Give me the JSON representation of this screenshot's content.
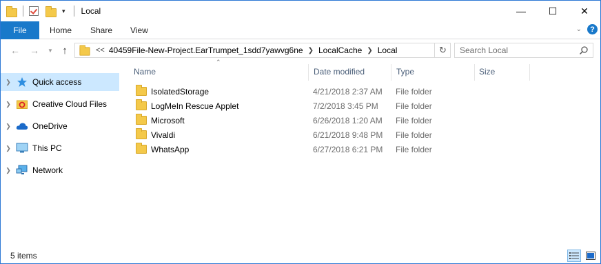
{
  "window": {
    "title": "Local",
    "controls": {
      "minimize": "—",
      "maximize": "☐",
      "close": "✕"
    }
  },
  "ribbon": {
    "tabs": [
      {
        "label": "File"
      },
      {
        "label": "Home"
      },
      {
        "label": "Share"
      },
      {
        "label": "View"
      }
    ],
    "collapse_icon": "chevron-down-icon",
    "help_label": "?"
  },
  "address": {
    "overflow": "<<",
    "crumbs": [
      "40459File-New-Project.EarTrumpet_1sdd7yawvg6ne",
      "LocalCache",
      "Local"
    ],
    "search_placeholder": "Search Local"
  },
  "nav": {
    "items": [
      {
        "label": "Quick access",
        "icon": "star-icon",
        "selected": true
      },
      {
        "label": "Creative Cloud Files",
        "icon": "creative-cloud-folder-icon",
        "selected": false
      },
      {
        "label": "OneDrive",
        "icon": "cloud-icon",
        "selected": false
      },
      {
        "label": "This PC",
        "icon": "computer-icon",
        "selected": false
      },
      {
        "label": "Network",
        "icon": "network-icon",
        "selected": false
      }
    ]
  },
  "files": {
    "columns": {
      "name": "Name",
      "date": "Date modified",
      "type": "Type",
      "size": "Size"
    },
    "rows": [
      {
        "name": "IsolatedStorage",
        "date": "4/21/2018 2:37 AM",
        "type": "File folder"
      },
      {
        "name": "LogMeIn Rescue Applet",
        "date": "7/2/2018 3:45 PM",
        "type": "File folder"
      },
      {
        "name": "Microsoft",
        "date": "6/26/2018 1:20 AM",
        "type": "File folder"
      },
      {
        "name": "Vivaldi",
        "date": "6/21/2018 9:48 PM",
        "type": "File folder"
      },
      {
        "name": "WhatsApp",
        "date": "6/27/2018 6:21 PM",
        "type": "File folder"
      }
    ]
  },
  "status": {
    "item_count": "5 items",
    "active_view": "details"
  },
  "colors": {
    "accent": "#1979ca",
    "selection": "#cce8ff",
    "folder": "#f4c94a",
    "header_text": "#4c607a",
    "secondary_text": "#6d6d6d"
  }
}
